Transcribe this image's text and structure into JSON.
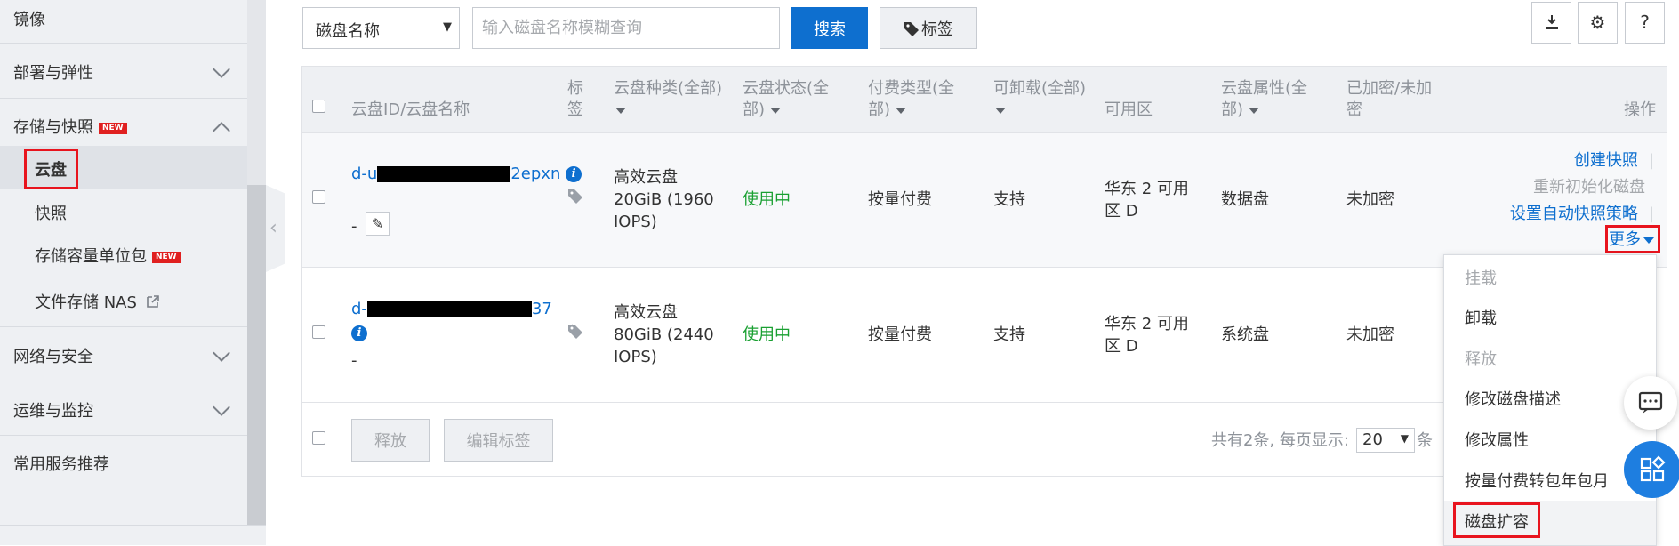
{
  "sidebar": {
    "mirror": "镜像",
    "deploy": "部署与弹性",
    "storage": "存储与快照",
    "storage_badge": "NEW",
    "disk": "云盘",
    "snapshot": "快照",
    "capacity": "存储容量单位包",
    "capacity_badge": "NEW",
    "nas": "文件存储 NAS",
    "network": "网络与安全",
    "ops": "运维与监控",
    "common": "常用服务推荐"
  },
  "toolbar": {
    "filter_value": "磁盘名称",
    "search_placeholder": "输入磁盘名称模糊查询",
    "search_label": "搜索",
    "tag_label": "标签",
    "help": "?"
  },
  "table": {
    "headers": {
      "id": "云盘ID/云盘名称",
      "tag_1": "标",
      "tag_2": "签",
      "type_1": "云盘种类(全部)",
      "status_1": "云盘状态(全",
      "status_2": "部)",
      "pay_1": "付费类型(全",
      "pay_2": "部)",
      "detach": "可卸载(全部)",
      "zone": "可用区",
      "attr_1": "云盘属性(全",
      "attr_2": "部)",
      "enc_1": "已加密/未加",
      "enc_2": "密",
      "ops": "操作"
    },
    "rows": [
      {
        "id_prefix": "d-u",
        "id_suffix": "2epxn",
        "name": "-",
        "type_1": "高效云盘",
        "type_2": "20GiB (1960",
        "type_3": "IOPS)",
        "status": "使用中",
        "pay": "按量付费",
        "detach": "支持",
        "zone_1": "华东 2 可用",
        "zone_2": "区 D",
        "attr": "数据盘",
        "enc": "未加密"
      },
      {
        "id_prefix": "d-",
        "id_suffix": "37",
        "name": "-",
        "type_1": "高效云盘",
        "type_2": "80GiB (2440",
        "type_3": "IOPS)",
        "status": "使用中",
        "pay": "按量付费",
        "detach": "支持",
        "zone_1": "华东 2 可用",
        "zone_2": "区 D",
        "attr": "系统盘",
        "enc": "未加密"
      }
    ],
    "row_ops": {
      "snapshot": "创建快照",
      "reinit": "重新初始化磁盘",
      "auto_policy": "设置自动快照策略",
      "more": "更多"
    },
    "footer": {
      "release": "释放",
      "edit_tags": "编辑标签",
      "summary": "共有2条, 每页显示:",
      "page_size": "20",
      "unit": "条"
    }
  },
  "more_menu": {
    "items": [
      "挂载",
      "卸载",
      "释放",
      "修改磁盘描述",
      "修改属性",
      "按量付费转包年包月",
      "磁盘扩容"
    ]
  }
}
